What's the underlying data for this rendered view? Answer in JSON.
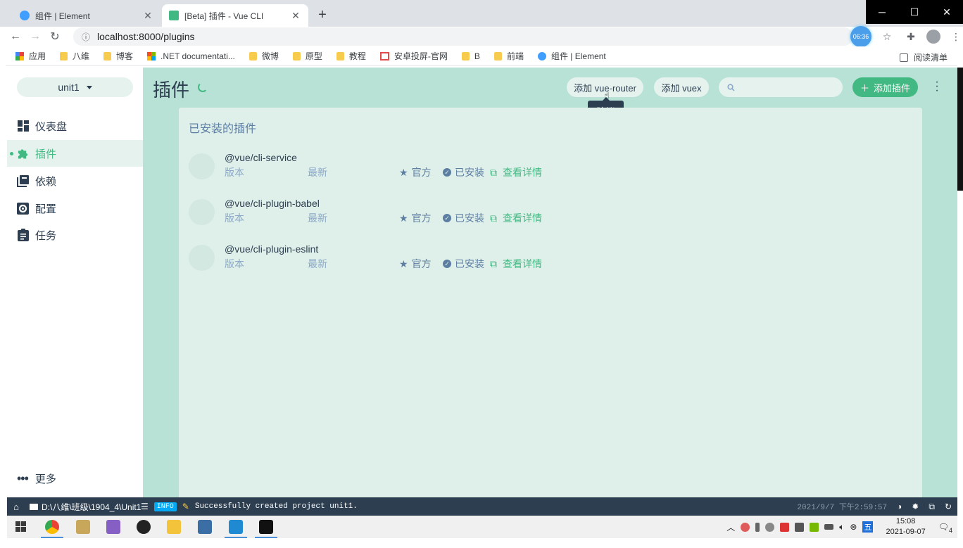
{
  "browser": {
    "tabs": [
      {
        "title": "组件 | Element",
        "active": false
      },
      {
        "title": "[Beta] 插件 - Vue CLI",
        "active": true
      }
    ],
    "new_tab": "+",
    "url": "localhost:8000/plugins",
    "timer_badge": "06:36",
    "bookmarks": [
      {
        "label": "应用",
        "icon": "apps-grid-icon"
      },
      {
        "label": "八维",
        "icon": "folder-icon"
      },
      {
        "label": "博客",
        "icon": "folder-icon"
      },
      {
        "label": ".NET documentati...",
        "icon": "microsoft-icon"
      },
      {
        "label": "微博",
        "icon": "folder-icon"
      },
      {
        "label": "原型",
        "icon": "folder-icon"
      },
      {
        "label": "教程",
        "icon": "folder-icon"
      },
      {
        "label": "安卓投屏-官网",
        "icon": "red-screen-icon"
      },
      {
        "label": "B",
        "icon": "folder-icon"
      },
      {
        "label": "前端",
        "icon": "folder-icon"
      },
      {
        "label": "组件 | Element",
        "icon": "element-icon"
      }
    ],
    "reading_list": "阅读清单"
  },
  "sidebar": {
    "project": "unit1",
    "items": [
      {
        "label": "仪表盘",
        "icon": "dashboard-icon",
        "active": false
      },
      {
        "label": "插件",
        "icon": "puzzle-icon",
        "active": true
      },
      {
        "label": "依赖",
        "icon": "library-icon",
        "active": false
      },
      {
        "label": "配置",
        "icon": "settings-icon",
        "active": false
      },
      {
        "label": "任务",
        "icon": "assignment-icon",
        "active": false
      }
    ],
    "more": "更多"
  },
  "header": {
    "title": "插件",
    "add_router": "添加 vue-router",
    "add_vuex": "添加 vuex",
    "tooltip": "建议",
    "search_placeholder": "",
    "add_plugin": "添加插件"
  },
  "installed": {
    "title": "已安装的插件",
    "plugins": [
      {
        "name": "@vue/cli-service",
        "version": "版本",
        "latest": "最新",
        "official": "官方",
        "installed": "已安装",
        "details": "查看详情"
      },
      {
        "name": "@vue/cli-plugin-babel",
        "version": "版本",
        "latest": "最新",
        "official": "官方",
        "installed": "已安装",
        "details": "查看详情"
      },
      {
        "name": "@vue/cli-plugin-eslint",
        "version": "版本",
        "latest": "最新",
        "official": "官方",
        "installed": "已安装",
        "details": "查看详情"
      }
    ]
  },
  "statusbar": {
    "path": "D:\\八维\\班级\\1904_4\\Unit1",
    "log_level": "INFO",
    "log_message": "Successfully created project unit1.",
    "log_time": "2021/9/7 下午2:59:57"
  },
  "taskbar": {
    "time": "15:08",
    "date": "2021-09-07",
    "notifications": "4",
    "ime": "五"
  },
  "colors": {
    "accent": "#42b983",
    "main_bg": "#b8e2d5",
    "panel_bg": "#dff0ea",
    "statusbar_bg": "#2c3e50"
  }
}
